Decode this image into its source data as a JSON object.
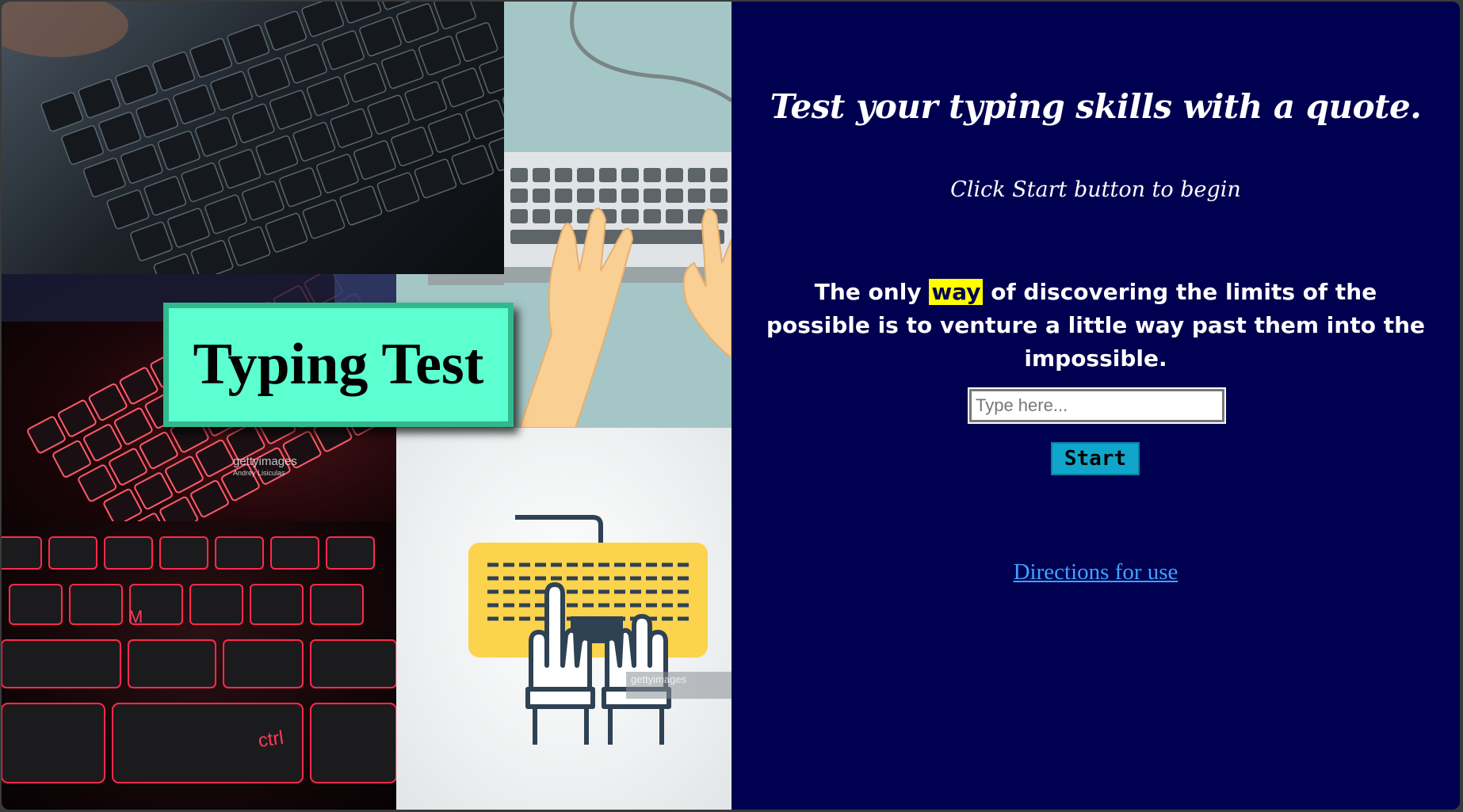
{
  "collage": {
    "title": "Typing Test",
    "watermark_1": "gettyimages",
    "watermark_1_credit": "Andrey Lisiculas",
    "watermark_2": "gettyimages"
  },
  "panel": {
    "heading": "Test your typing skills with a quote.",
    "subheading": "Click Start button to begin",
    "quote_before": "The only ",
    "quote_highlight": "way",
    "quote_after": " of discovering the limits of the possible is to venture a little way past them into the impossible.",
    "input_placeholder": "Type here...",
    "start_label": "Start",
    "directions_label": "Directions for use"
  },
  "colors": {
    "panel_bg": "#000050",
    "title_card_bg": "#5cffd0",
    "highlight": "#ffff00",
    "start_button": "#10a6cc",
    "link": "#3fa3ff"
  }
}
